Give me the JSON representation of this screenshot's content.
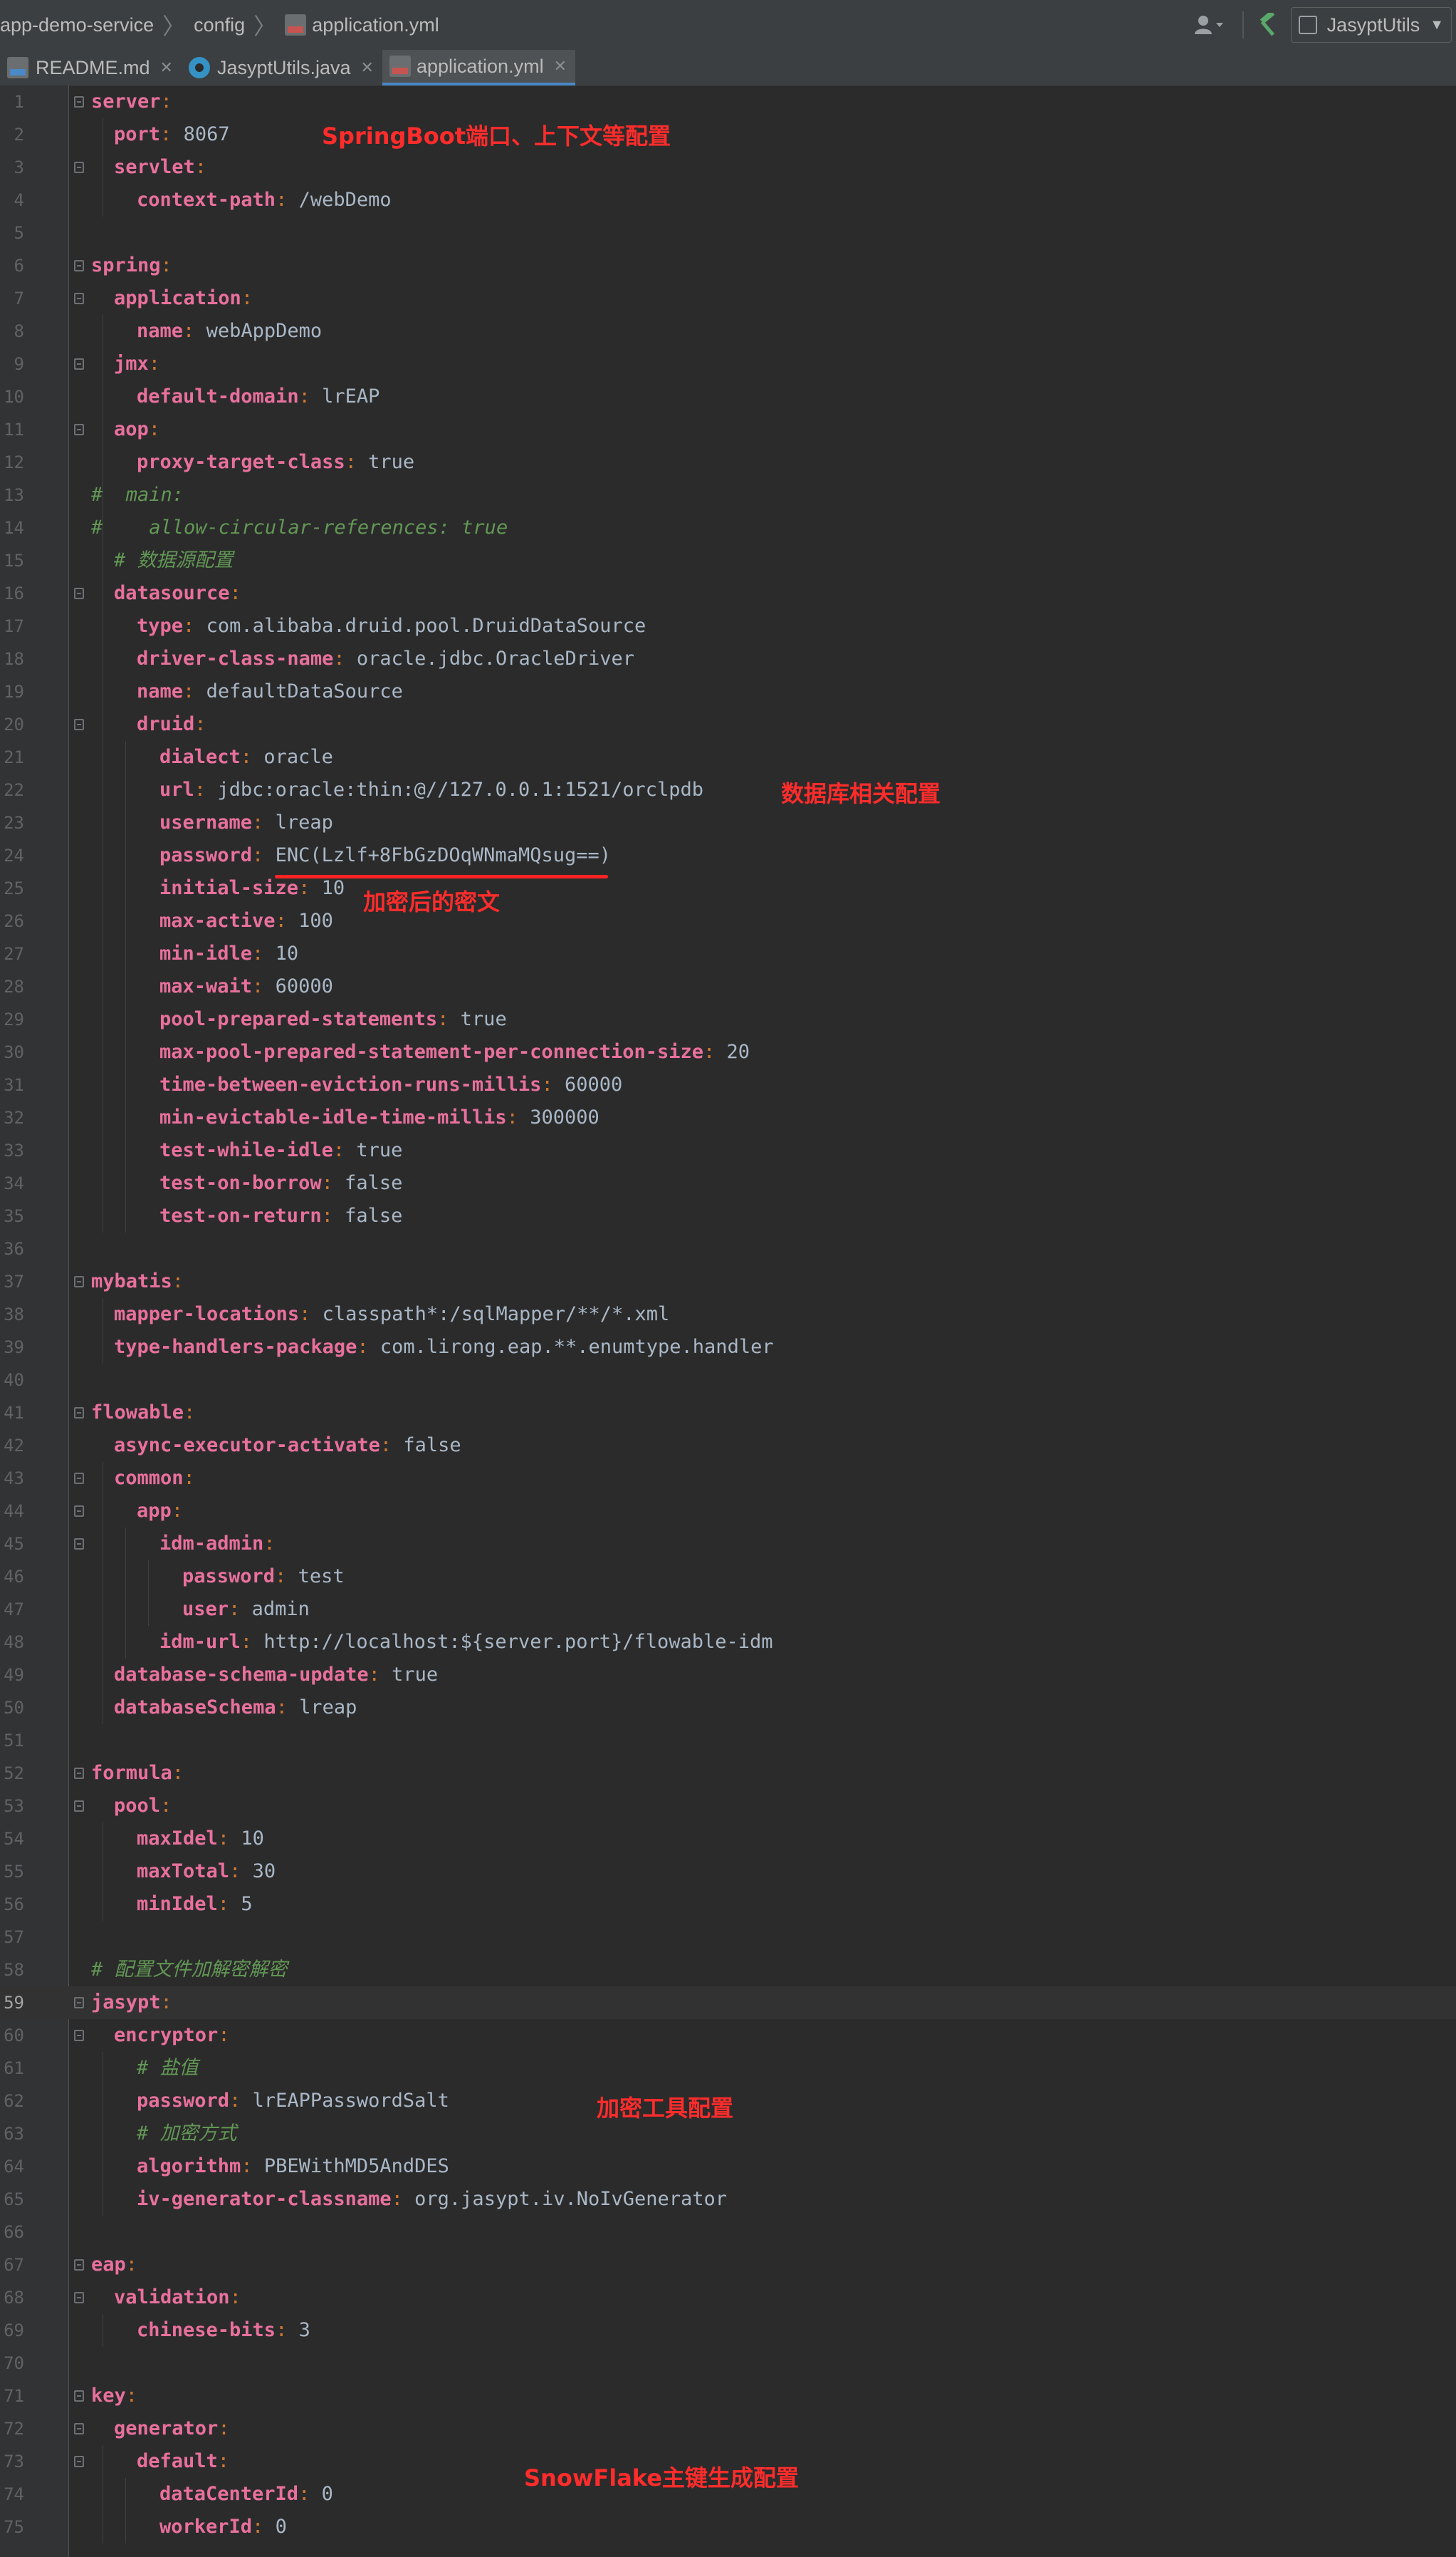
{
  "breadcrumbs": [
    {
      "label": "app-demo-service",
      "icon": null
    },
    {
      "label": "config",
      "icon": null
    },
    {
      "label": "application.yml",
      "icon": "yml-file-icon"
    }
  ],
  "toolbar": {
    "run_config_label": "JasyptUtils"
  },
  "tabs": [
    {
      "label": "README.md",
      "icon": "markdown-file-icon",
      "active": false
    },
    {
      "label": "JasyptUtils.java",
      "icon": "java-class-icon",
      "active": false
    },
    {
      "label": "application.yml",
      "icon": "yml-file-icon",
      "active": true
    }
  ],
  "editor": {
    "current_line": 59,
    "lines": [
      {
        "n": "1",
        "indent": 0,
        "key": "server",
        "value": ""
      },
      {
        "n": "2",
        "indent": 1,
        "key": "port",
        "value": "8067"
      },
      {
        "n": "3",
        "indent": 1,
        "key": "servlet",
        "value": ""
      },
      {
        "n": "4",
        "indent": 2,
        "key": "context-path",
        "value": "/webDemo"
      },
      {
        "n": "5",
        "indent": 0,
        "key": "",
        "value": ""
      },
      {
        "n": "6",
        "indent": 0,
        "key": "spring",
        "value": ""
      },
      {
        "n": "7",
        "indent": 1,
        "key": "application",
        "value": ""
      },
      {
        "n": "8",
        "indent": 2,
        "key": "name",
        "value": "webAppDemo"
      },
      {
        "n": "9",
        "indent": 1,
        "key": "jmx",
        "value": ""
      },
      {
        "n": "10",
        "indent": 2,
        "key": "default-domain",
        "value": "lrEAP"
      },
      {
        "n": "11",
        "indent": 1,
        "key": "aop",
        "value": ""
      },
      {
        "n": "12",
        "indent": 2,
        "key": "proxy-target-class",
        "value": "true"
      },
      {
        "n": "13",
        "indent": 0,
        "comment": "#  main:"
      },
      {
        "n": "14",
        "indent": 0,
        "comment": "#    allow-circular-references: true"
      },
      {
        "n": "15",
        "indent": 1,
        "comment": "# 数据源配置"
      },
      {
        "n": "16",
        "indent": 1,
        "key": "datasource",
        "value": ""
      },
      {
        "n": "17",
        "indent": 2,
        "key": "type",
        "value": "com.alibaba.druid.pool.DruidDataSource"
      },
      {
        "n": "18",
        "indent": 2,
        "key": "driver-class-name",
        "value": "oracle.jdbc.OracleDriver"
      },
      {
        "n": "19",
        "indent": 2,
        "key": "name",
        "value": "defaultDataSource"
      },
      {
        "n": "20",
        "indent": 2,
        "key": "druid",
        "value": ""
      },
      {
        "n": "21",
        "indent": 3,
        "key": "dialect",
        "value": "oracle"
      },
      {
        "n": "22",
        "indent": 3,
        "key": "url",
        "value": "jdbc:oracle:thin:@//127.0.0.1:1521/orclpdb"
      },
      {
        "n": "23",
        "indent": 3,
        "key": "username",
        "value": "lreap"
      },
      {
        "n": "24",
        "indent": 3,
        "key": "password",
        "value": "ENC(Lzlf+8FbGzDOqWNmaMQsug==)"
      },
      {
        "n": "25",
        "indent": 3,
        "key": "initial-size",
        "value": "10"
      },
      {
        "n": "26",
        "indent": 3,
        "key": "max-active",
        "value": "100"
      },
      {
        "n": "27",
        "indent": 3,
        "key": "min-idle",
        "value": "10"
      },
      {
        "n": "28",
        "indent": 3,
        "key": "max-wait",
        "value": "60000"
      },
      {
        "n": "29",
        "indent": 3,
        "key": "pool-prepared-statements",
        "value": "true"
      },
      {
        "n": "30",
        "indent": 3,
        "key": "max-pool-prepared-statement-per-connection-size",
        "value": "20"
      },
      {
        "n": "31",
        "indent": 3,
        "key": "time-between-eviction-runs-millis",
        "value": "60000"
      },
      {
        "n": "32",
        "indent": 3,
        "key": "min-evictable-idle-time-millis",
        "value": "300000"
      },
      {
        "n": "33",
        "indent": 3,
        "key": "test-while-idle",
        "value": "true"
      },
      {
        "n": "34",
        "indent": 3,
        "key": "test-on-borrow",
        "value": "false"
      },
      {
        "n": "35",
        "indent": 3,
        "key": "test-on-return",
        "value": "false"
      },
      {
        "n": "36",
        "indent": 0,
        "key": "",
        "value": ""
      },
      {
        "n": "37",
        "indent": 0,
        "key": "mybatis",
        "value": ""
      },
      {
        "n": "38",
        "indent": 1,
        "key": "mapper-locations",
        "value": "classpath*:/sqlMapper/**/*.xml"
      },
      {
        "n": "39",
        "indent": 1,
        "key": "type-handlers-package",
        "value": "com.lirong.eap.**.enumtype.handler"
      },
      {
        "n": "40",
        "indent": 0,
        "key": "",
        "value": ""
      },
      {
        "n": "41",
        "indent": 0,
        "key": "flowable",
        "value": ""
      },
      {
        "n": "42",
        "indent": 1,
        "key": "async-executor-activate",
        "value": "false"
      },
      {
        "n": "43",
        "indent": 1,
        "key": "common",
        "value": ""
      },
      {
        "n": "44",
        "indent": 2,
        "key": "app",
        "value": ""
      },
      {
        "n": "45",
        "indent": 3,
        "key": "idm-admin",
        "value": ""
      },
      {
        "n": "46",
        "indent": 4,
        "key": "password",
        "value": "test"
      },
      {
        "n": "47",
        "indent": 4,
        "key": "user",
        "value": "admin"
      },
      {
        "n": "48",
        "indent": 3,
        "key": "idm-url",
        "value": "http://localhost:${server.port}/flowable-idm"
      },
      {
        "n": "49",
        "indent": 1,
        "key": "database-schema-update",
        "value": "true"
      },
      {
        "n": "50",
        "indent": 1,
        "key": "databaseSchema",
        "value": "lreap"
      },
      {
        "n": "51",
        "indent": 0,
        "key": "",
        "value": ""
      },
      {
        "n": "52",
        "indent": 0,
        "key": "formula",
        "value": ""
      },
      {
        "n": "53",
        "indent": 1,
        "key": "pool",
        "value": ""
      },
      {
        "n": "54",
        "indent": 2,
        "key": "maxIdel",
        "value": "10"
      },
      {
        "n": "55",
        "indent": 2,
        "key": "maxTotal",
        "value": "30"
      },
      {
        "n": "56",
        "indent": 2,
        "key": "minIdel",
        "value": "5"
      },
      {
        "n": "57",
        "indent": 0,
        "key": "",
        "value": ""
      },
      {
        "n": "58",
        "indent": 0,
        "comment": "# 配置文件加解密解密"
      },
      {
        "n": "59",
        "indent": 0,
        "key": "jasypt",
        "value": ""
      },
      {
        "n": "60",
        "indent": 1,
        "key": "encryptor",
        "value": ""
      },
      {
        "n": "61",
        "indent": 2,
        "comment": "# 盐值"
      },
      {
        "n": "62",
        "indent": 2,
        "key": "password",
        "value": "lrEAPPasswordSalt"
      },
      {
        "n": "63",
        "indent": 2,
        "comment": "# 加密方式"
      },
      {
        "n": "64",
        "indent": 2,
        "key": "algorithm",
        "value": "PBEWithMD5AndDES"
      },
      {
        "n": "65",
        "indent": 2,
        "key": "iv-generator-classname",
        "value": "org.jasypt.iv.NoIvGenerator"
      },
      {
        "n": "66",
        "indent": 0,
        "key": "",
        "value": ""
      },
      {
        "n": "67",
        "indent": 0,
        "key": "eap",
        "value": ""
      },
      {
        "n": "68",
        "indent": 1,
        "key": "validation",
        "value": ""
      },
      {
        "n": "69",
        "indent": 2,
        "key": "chinese-bits",
        "value": "3"
      },
      {
        "n": "70",
        "indent": 0,
        "key": "",
        "value": ""
      },
      {
        "n": "71",
        "indent": 0,
        "key": "key",
        "value": ""
      },
      {
        "n": "72",
        "indent": 1,
        "key": "generator",
        "value": ""
      },
      {
        "n": "73",
        "indent": 2,
        "key": "default",
        "value": ""
      },
      {
        "n": "74",
        "indent": 3,
        "key": "dataCenterId",
        "value": "0"
      },
      {
        "n": "75",
        "indent": 3,
        "key": "workerId",
        "value": "0"
      }
    ]
  },
  "annotations": {
    "springboot": "SpringBoot端口、上下文等配置",
    "database": "数据库相关配置",
    "encrypted": "加密后的密文",
    "jasypt": "加密工具配置",
    "snowflake": "SnowFlake主键生成配置"
  }
}
